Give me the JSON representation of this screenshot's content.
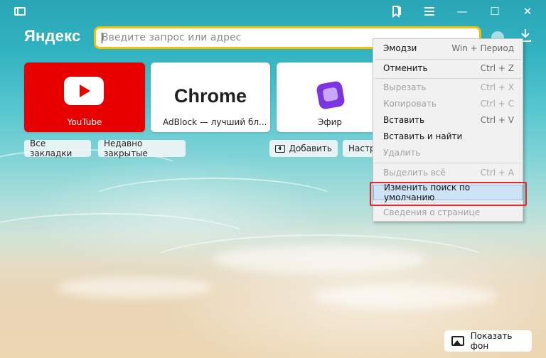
{
  "browser": {
    "logo": "Яндекс"
  },
  "titlebar": {
    "sidebar_icon": "sidebar-toggle-icon",
    "bookmark_icon": "bookmarks-icon",
    "menu_icon": "hamburger-menu-icon",
    "minimize_glyph": "—",
    "maximize_glyph": "☐",
    "close_glyph": "✕"
  },
  "search": {
    "placeholder": "Введите запрос или адрес"
  },
  "tiles": [
    {
      "label": "YouTube"
    },
    {
      "big_text": "Chrome",
      "label": "AdBlock — лучший бл..."
    },
    {
      "label": "Эфир"
    }
  ],
  "chips": {
    "bookmarks": "Все закладки",
    "recent": "Недавно закрытые",
    "add": "Добавить",
    "settings": "Настр"
  },
  "context_menu": {
    "items": [
      {
        "label": "Эмодзи",
        "shortcut": "Win + Период",
        "enabled": true
      },
      {
        "label": "Отменить",
        "shortcut": "Ctrl + Z",
        "enabled": true
      },
      {
        "label": "Вырезать",
        "shortcut": "Ctrl + X",
        "enabled": false
      },
      {
        "label": "Копировать",
        "shortcut": "Ctrl + C",
        "enabled": false
      },
      {
        "label": "Вставить",
        "shortcut": "Ctrl + V",
        "enabled": true
      },
      {
        "label": "Вставить и найти",
        "shortcut": "",
        "enabled": true
      },
      {
        "label": "Удалить",
        "shortcut": "",
        "enabled": false
      },
      {
        "label": "Выделить всё",
        "shortcut": "Ctrl + A",
        "enabled": false
      },
      {
        "label": "Изменить поиск по умолчанию",
        "shortcut": "",
        "enabled": true,
        "highlighted": true
      },
      {
        "label": "Сведения о странице",
        "shortcut": "",
        "enabled": false
      }
    ]
  },
  "show_background": {
    "label": "Показать фон"
  },
  "colors": {
    "accent_search_border": "#f5c100",
    "highlight_frame": "#e2262f",
    "youtube_red": "#e80000"
  }
}
